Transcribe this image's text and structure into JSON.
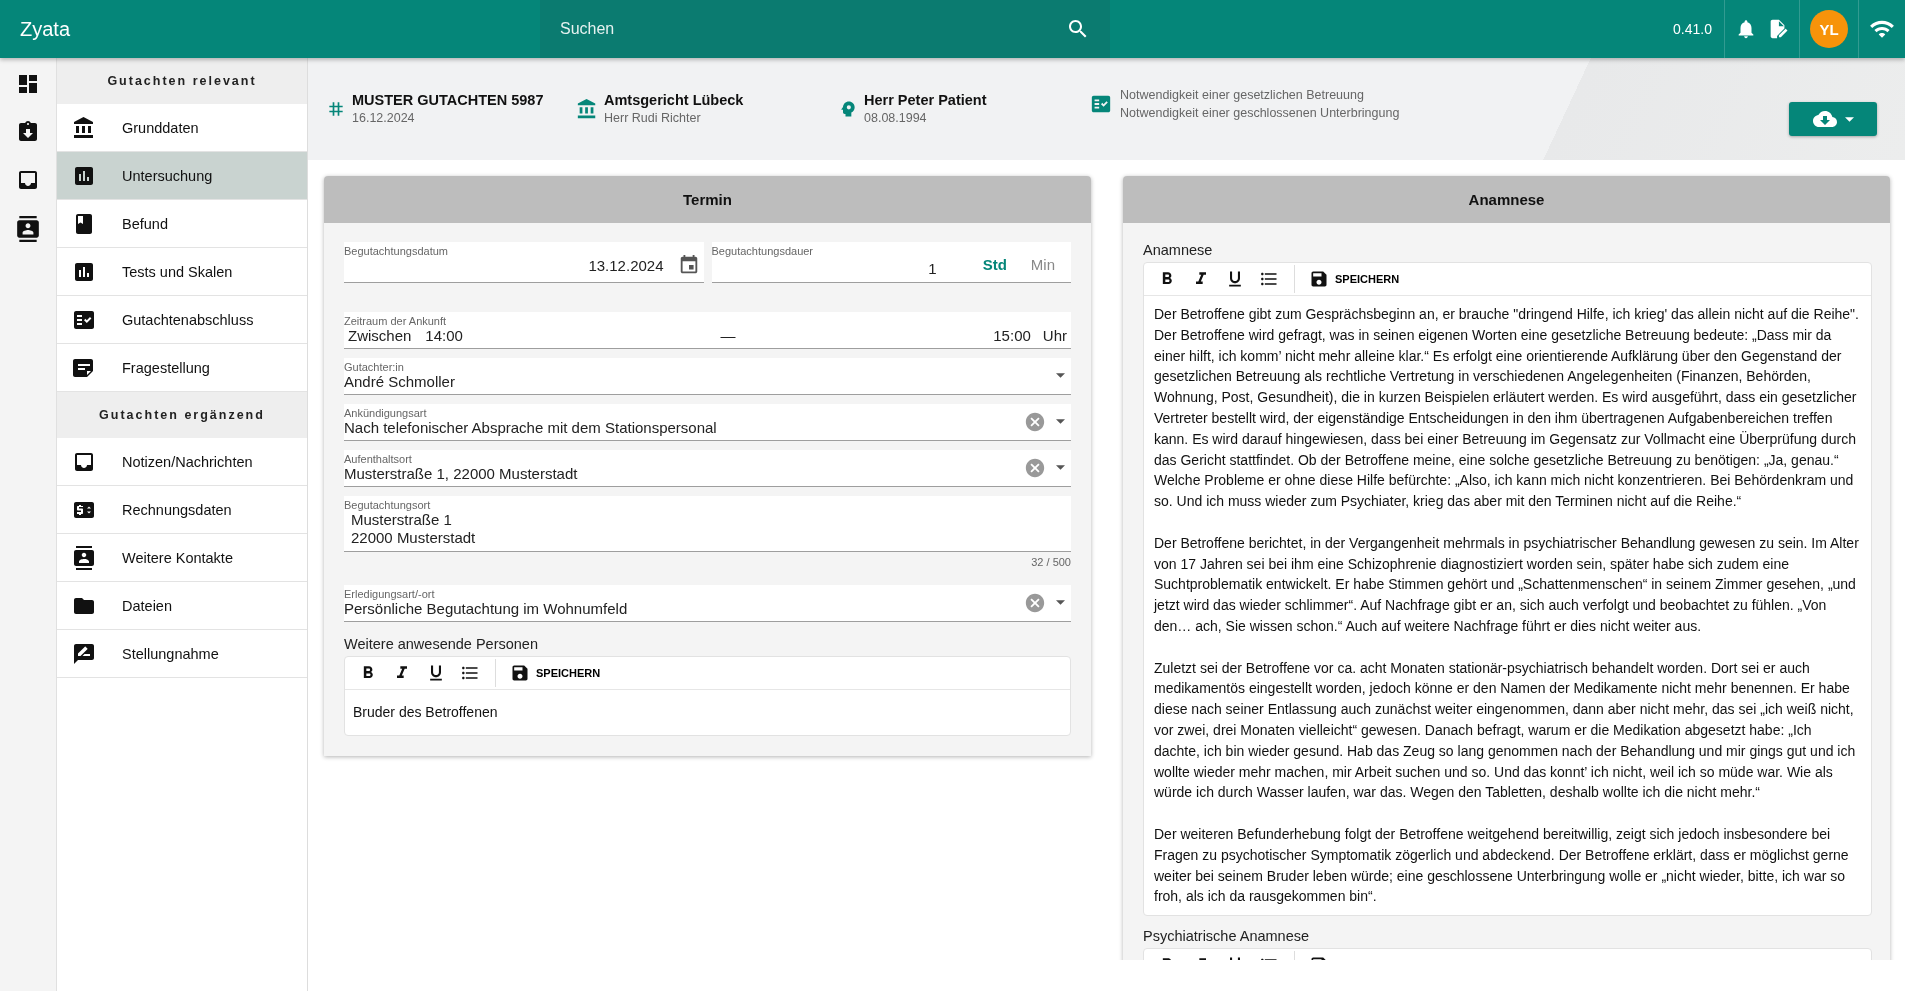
{
  "app": {
    "title": "Zyata",
    "search_placeholder": "Suchen",
    "version": "0.41.0",
    "avatar": "YL"
  },
  "sidebar": {
    "sections": [
      {
        "title": "Gutachten relevant",
        "items": [
          {
            "label": "Grunddaten",
            "kind": "bank",
            "selected": false
          },
          {
            "label": "Untersuchung",
            "kind": "chart",
            "selected": true
          },
          {
            "label": "Befund",
            "kind": "book",
            "selected": false
          },
          {
            "label": "Tests und Skalen",
            "kind": "chart",
            "selected": false
          },
          {
            "label": "Gutachtenabschluss",
            "kind": "checklist",
            "selected": false
          },
          {
            "label": "Fragestellung",
            "kind": "note",
            "selected": false
          }
        ]
      },
      {
        "title": "Gutachten ergänzend",
        "items": [
          {
            "label": "Notizen/Nachrichten",
            "kind": "inbox",
            "selected": false
          },
          {
            "label": "Rechnungsdaten",
            "kind": "money",
            "selected": false
          },
          {
            "label": "Weitere Kontakte",
            "kind": "contacts",
            "selected": false
          },
          {
            "label": "Dateien",
            "kind": "folder",
            "selected": false
          },
          {
            "label": "Stellungnahme",
            "kind": "review",
            "selected": false
          }
        ]
      }
    ]
  },
  "case_header": {
    "case": {
      "title": "MUSTER GUTACHTEN 5987",
      "date": "16.12.2024"
    },
    "court": {
      "name": "Amtsgericht Lübeck",
      "judge": "Herr Rudi Richter"
    },
    "patient": {
      "name": "Herr Peter Patient",
      "birthdate": "08.08.1994"
    },
    "notes": [
      "Notwendigkeit einer gesetzlichen Betreuung",
      "Notwendigkeit einer geschlossenen Unterbringung"
    ]
  },
  "termin": {
    "title": "Termin",
    "date": {
      "label": "Begutachtungsdatum",
      "value": "13.12.2024"
    },
    "duration": {
      "label": "Begutachtungsdauer",
      "value": "1",
      "units": [
        {
          "label": "Std",
          "selected": true
        },
        {
          "label": "Min",
          "selected": false
        }
      ]
    },
    "arrival": {
      "label": "Zeitraum der Ankunft",
      "prefix": "Zwischen",
      "from": "14:00",
      "separator": "—",
      "to": "15:00",
      "suffix": "Uhr"
    },
    "fields": [
      {
        "kind": "select",
        "label": "Gutachter:in",
        "value": "André Schmoller",
        "clearable": false
      },
      {
        "kind": "select",
        "label": "Ankündigungsart",
        "value": "Nach telefonischer Absprache mit dem Stationspersonal",
        "clearable": true
      },
      {
        "kind": "select",
        "label": "Aufenthaltsort",
        "value": "Musterstraße 1, 22000 Musterstadt",
        "clearable": true
      },
      {
        "kind": "textarea",
        "label": "Begutachtungsort",
        "value": "Musterstraße 1\n22000 Musterstadt",
        "counter": "32 / 500"
      },
      {
        "kind": "select",
        "label": "Erledigungsart/-ort",
        "value": "Persönliche Begutachtung im Wohnumfeld",
        "clearable": true
      }
    ],
    "persons": {
      "label": "Weitere anwesende Personen",
      "save": "SPEICHERN",
      "paragraphs": [
        "Bruder des Betroffenen"
      ]
    }
  },
  "anamnese": {
    "title": "Anamnese",
    "editors": [
      {
        "label": "Anamnese",
        "save": "SPEICHERN",
        "paragraphs": [
          "Der Betroffene gibt zum Gesprächsbeginn an, er brauche \"dringend Hilfe, ich krieg' das allein nicht auf die Reihe\". Der Betroffene wird gefragt, was in seinen eigenen Worten eine gesetzliche Betreuung bedeute: „Dass mir da einer hilft, ich komm’ nicht mehr alleine klar.“ Es erfolgt eine orientierende Aufklärung über den Gegenstand der gesetzlichen Betreuung als rechtliche Vertretung in verschiedenen Angelegenheiten (Finanzen, Behörden, Wohnung, Post, Gesundheit), die in kurzen Beispielen erläutert werden. Es wird ausgeführt, dass ein gesetzlicher Vertreter bestellt wird, der eigenständige Entscheidungen in den ihm übertragenen Aufgabenbereichen treffen kann. Es wird darauf hingewiesen, dass bei einer Betreuung im Gegensatz zur Vollmacht eine Überprüfung durch das Gericht stattfindet. Ob der Betroffene meine, eine solche gesetzliche Betreuung zu benötigen: „Ja, genau.“ Welche Probleme er ohne diese Hilfe befürchte: „Also, ich kann mich nicht konzentrieren. Bei Behördenkram und so. Und ich muss wieder zum Psychiater, krieg das aber mit den Terminen nicht auf die Reihe.“",
          "Der Betroffene berichtet, in der Vergangenheit mehrmals in psychiatrischer Behandlung gewesen zu sein. Im Alter von 17 Jahren sei bei ihm eine Schizophrenie diagnostiziert worden sein, später habe sich zudem eine Suchtproblematik entwickelt. Er habe Stimmen gehört und „Schattenmenschen“ in seinem Zimmer gesehen, „und jetzt wird das wieder schlimmer“. Auf Nachfrage gibt er an, sich auch verfolgt und beobachtet zu fühlen. „Von den… ach, Sie wissen schon.“ Auch auf weitere Nachfrage führt er dies nicht weiter aus.",
          "Zuletzt sei der Betroffene vor ca. acht Monaten stationär-psychiatrisch behandelt worden. Dort sei er auch medikamentös eingestellt worden, jedoch könne er den Namen der Medikamente nicht mehr benennen. Er habe diese nach seiner Entlassung auch zunächst weiter eingenommen, dann aber nicht mehr, das sei „ich weiß nicht, vor zwei, drei Monaten vielleicht“ gewesen. Danach befragt, warum er die Medikation abgesetzt habe: „Ich dachte, ich bin wieder gesund. Hab das Zeug so lang genommen nach der Behandlung und mir gings gut und ich wollte wieder mehr machen, mir Arbeit suchen und so. Und das konnt’ ich nicht, weil ich so müde war. Wie als würde ich durch Wasser laufen, war das. Wegen den Tabletten, deshalb wollte ich die nicht mehr.“",
          "Der weiteren Befunderhebung folgt der Betroffene weitgehend bereitwillig, zeigt sich jedoch insbesondere bei Fragen zu psychotischer Symptomatik zögerlich und abdeckend. Der Betroffene erklärt, dass er möglichst gerne weiter bei seinem Bruder leben würde; eine geschlossene Unterbringung wolle er „nicht wieder, bitte, ich war so froh, als ich da rausgekommen bin“."
        ]
      },
      {
        "label": "Psychiatrische Anamnese"
      }
    ]
  }
}
